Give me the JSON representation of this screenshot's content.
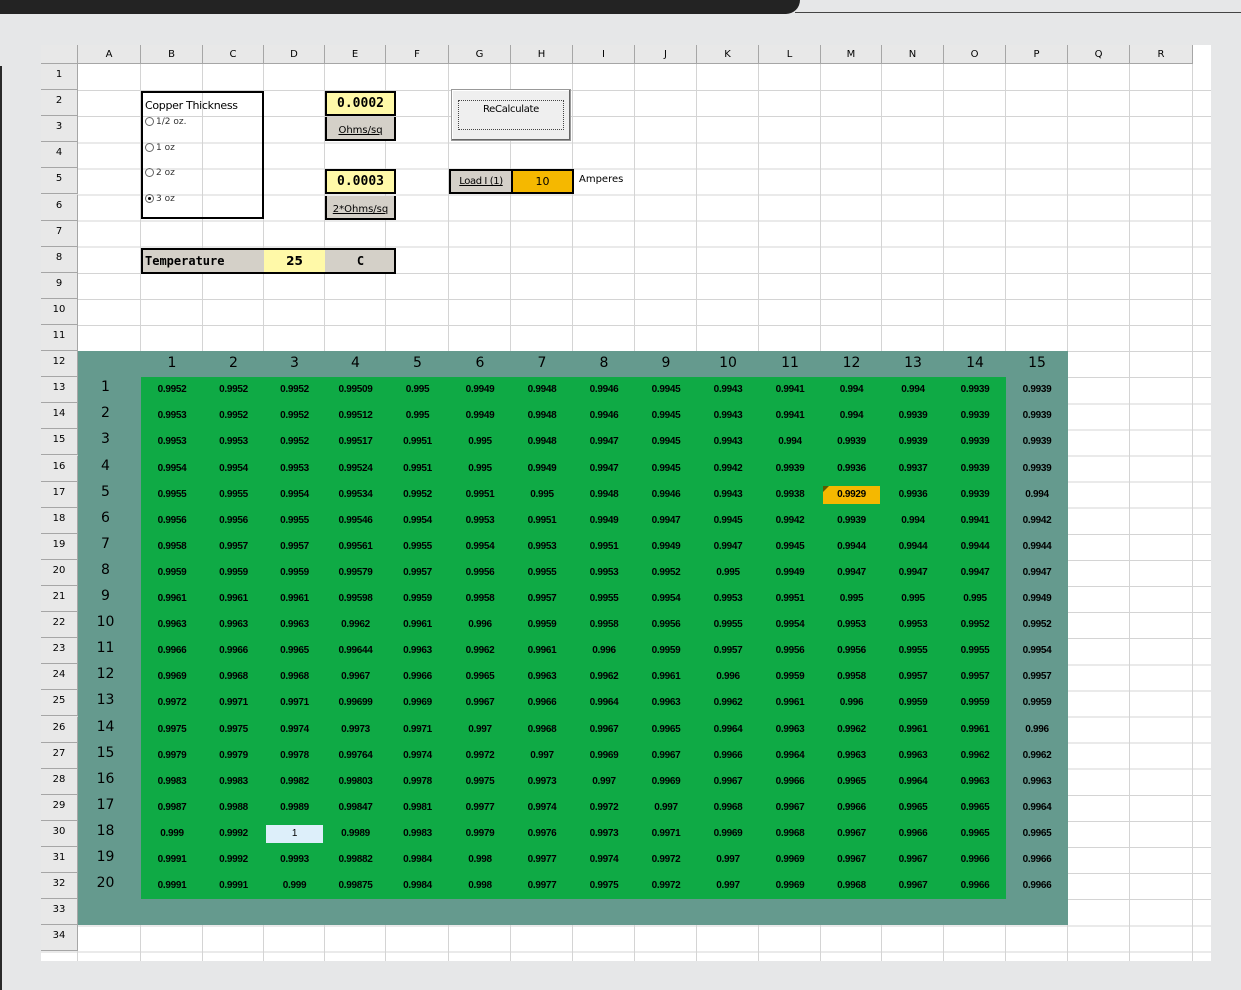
{
  "sheet": {
    "columns": [
      "A",
      "B",
      "C",
      "D",
      "E",
      "F",
      "G",
      "H",
      "I",
      "J",
      "K",
      "L",
      "M",
      "N",
      "O",
      "P",
      "Q",
      "R"
    ],
    "rows": [
      1,
      2,
      3,
      4,
      5,
      6,
      7,
      8,
      9,
      10,
      11,
      12,
      13,
      14,
      15,
      16,
      17,
      18,
      19,
      20,
      21,
      22,
      23,
      24,
      25,
      26,
      27,
      28,
      29,
      30,
      31,
      32,
      33,
      34
    ]
  },
  "copper": {
    "title": "Copper Thickness",
    "options": [
      "1/2 oz.",
      "1 oz",
      "2 oz",
      "3 oz"
    ],
    "selected_index": 3
  },
  "resistance": {
    "value": "0.0002",
    "unit": "Ohms/sq"
  },
  "resistance2": {
    "value": "0.0003",
    "unit": "2*Ohms/sq"
  },
  "temperature": {
    "label": "Temperature",
    "value": "25",
    "unit": "C"
  },
  "recalc_label": "ReCalculate",
  "load": {
    "label": "Load I (1)",
    "value": "10",
    "unit": "Amperes"
  },
  "matrix": {
    "col_headers": [
      "1",
      "2",
      "3",
      "4",
      "5",
      "6",
      "7",
      "8",
      "9",
      "10",
      "11",
      "12",
      "13",
      "14",
      "15"
    ],
    "row_headers": [
      "1",
      "2",
      "3",
      "4",
      "5",
      "6",
      "7",
      "8",
      "9",
      "10",
      "11",
      "12",
      "13",
      "14",
      "15",
      "16",
      "17",
      "18",
      "19",
      "20"
    ],
    "values": [
      [
        "0.9952",
        "0.9952",
        "0.9952",
        "0.99509",
        "0.995",
        "0.9949",
        "0.9948",
        "0.9946",
        "0.9945",
        "0.9943",
        "0.9941",
        "0.994",
        "0.994",
        "0.9939",
        "0.9939"
      ],
      [
        "0.9953",
        "0.9952",
        "0.9952",
        "0.99512",
        "0.995",
        "0.9949",
        "0.9948",
        "0.9946",
        "0.9945",
        "0.9943",
        "0.9941",
        "0.994",
        "0.9939",
        "0.9939",
        "0.9939"
      ],
      [
        "0.9953",
        "0.9953",
        "0.9952",
        "0.99517",
        "0.9951",
        "0.995",
        "0.9948",
        "0.9947",
        "0.9945",
        "0.9943",
        "0.994",
        "0.9939",
        "0.9939",
        "0.9939",
        "0.9939"
      ],
      [
        "0.9954",
        "0.9954",
        "0.9953",
        "0.99524",
        "0.9951",
        "0.995",
        "0.9949",
        "0.9947",
        "0.9945",
        "0.9942",
        "0.9939",
        "0.9936",
        "0.9937",
        "0.9939",
        "0.9939"
      ],
      [
        "0.9955",
        "0.9955",
        "0.9954",
        "0.99534",
        "0.9952",
        "0.9951",
        "0.995",
        "0.9948",
        "0.9946",
        "0.9943",
        "0.9938",
        "0.9929",
        "0.9936",
        "0.9939",
        "0.994"
      ],
      [
        "0.9956",
        "0.9956",
        "0.9955",
        "0.99546",
        "0.9954",
        "0.9953",
        "0.9951",
        "0.9949",
        "0.9947",
        "0.9945",
        "0.9942",
        "0.9939",
        "0.994",
        "0.9941",
        "0.9942"
      ],
      [
        "0.9958",
        "0.9957",
        "0.9957",
        "0.99561",
        "0.9955",
        "0.9954",
        "0.9953",
        "0.9951",
        "0.9949",
        "0.9947",
        "0.9945",
        "0.9944",
        "0.9944",
        "0.9944",
        "0.9944"
      ],
      [
        "0.9959",
        "0.9959",
        "0.9959",
        "0.99579",
        "0.9957",
        "0.9956",
        "0.9955",
        "0.9953",
        "0.9952",
        "0.995",
        "0.9949",
        "0.9947",
        "0.9947",
        "0.9947",
        "0.9947"
      ],
      [
        "0.9961",
        "0.9961",
        "0.9961",
        "0.99598",
        "0.9959",
        "0.9958",
        "0.9957",
        "0.9955",
        "0.9954",
        "0.9953",
        "0.9951",
        "0.995",
        "0.995",
        "0.995",
        "0.9949"
      ],
      [
        "0.9963",
        "0.9963",
        "0.9963",
        "0.9962",
        "0.9961",
        "0.996",
        "0.9959",
        "0.9958",
        "0.9956",
        "0.9955",
        "0.9954",
        "0.9953",
        "0.9953",
        "0.9952",
        "0.9952"
      ],
      [
        "0.9966",
        "0.9966",
        "0.9965",
        "0.99644",
        "0.9963",
        "0.9962",
        "0.9961",
        "0.996",
        "0.9959",
        "0.9957",
        "0.9956",
        "0.9956",
        "0.9955",
        "0.9955",
        "0.9954"
      ],
      [
        "0.9969",
        "0.9968",
        "0.9968",
        "0.9967",
        "0.9966",
        "0.9965",
        "0.9963",
        "0.9962",
        "0.9961",
        "0.996",
        "0.9959",
        "0.9958",
        "0.9957",
        "0.9957",
        "0.9957"
      ],
      [
        "0.9972",
        "0.9971",
        "0.9971",
        "0.99699",
        "0.9969",
        "0.9967",
        "0.9966",
        "0.9964",
        "0.9963",
        "0.9962",
        "0.9961",
        "0.996",
        "0.9959",
        "0.9959",
        "0.9959"
      ],
      [
        "0.9975",
        "0.9975",
        "0.9974",
        "0.9973",
        "0.9971",
        "0.997",
        "0.9968",
        "0.9967",
        "0.9965",
        "0.9964",
        "0.9963",
        "0.9962",
        "0.9961",
        "0.9961",
        "0.996"
      ],
      [
        "0.9979",
        "0.9979",
        "0.9978",
        "0.99764",
        "0.9974",
        "0.9972",
        "0.997",
        "0.9969",
        "0.9967",
        "0.9966",
        "0.9964",
        "0.9963",
        "0.9963",
        "0.9962",
        "0.9962"
      ],
      [
        "0.9983",
        "0.9983",
        "0.9982",
        "0.99803",
        "0.9978",
        "0.9975",
        "0.9973",
        "0.997",
        "0.9969",
        "0.9967",
        "0.9966",
        "0.9965",
        "0.9964",
        "0.9963",
        "0.9963"
      ],
      [
        "0.9987",
        "0.9988",
        "0.9989",
        "0.99847",
        "0.9981",
        "0.9977",
        "0.9974",
        "0.9972",
        "0.997",
        "0.9968",
        "0.9967",
        "0.9966",
        "0.9965",
        "0.9965",
        "0.9964"
      ],
      [
        "0.999",
        "0.9992",
        "1",
        "0.9989",
        "0.9983",
        "0.9979",
        "0.9976",
        "0.9973",
        "0.9971",
        "0.9969",
        "0.9968",
        "0.9967",
        "0.9966",
        "0.9965",
        "0.9965"
      ],
      [
        "0.9991",
        "0.9992",
        "0.9993",
        "0.99882",
        "0.9984",
        "0.998",
        "0.9977",
        "0.9974",
        "0.9972",
        "0.997",
        "0.9969",
        "0.9967",
        "0.9967",
        "0.9966",
        "0.9966"
      ],
      [
        "0.9991",
        "0.9991",
        "0.999",
        "0.99875",
        "0.9984",
        "0.998",
        "0.9977",
        "0.9975",
        "0.9972",
        "0.997",
        "0.9969",
        "0.9968",
        "0.9967",
        "0.9966",
        "0.9966"
      ]
    ],
    "min_cell": {
      "row": 5,
      "col": 12
    },
    "max_cell": {
      "row": 18,
      "col": 3
    }
  },
  "colors": {
    "frame": "#659a8e",
    "green": "#0faa45",
    "min_highlight": "#f5b800",
    "max_highlight": "#ddeffa",
    "yellow_input": "#fff9a8",
    "load_input": "#f5b800",
    "grey_label": "#d4d0c8"
  }
}
